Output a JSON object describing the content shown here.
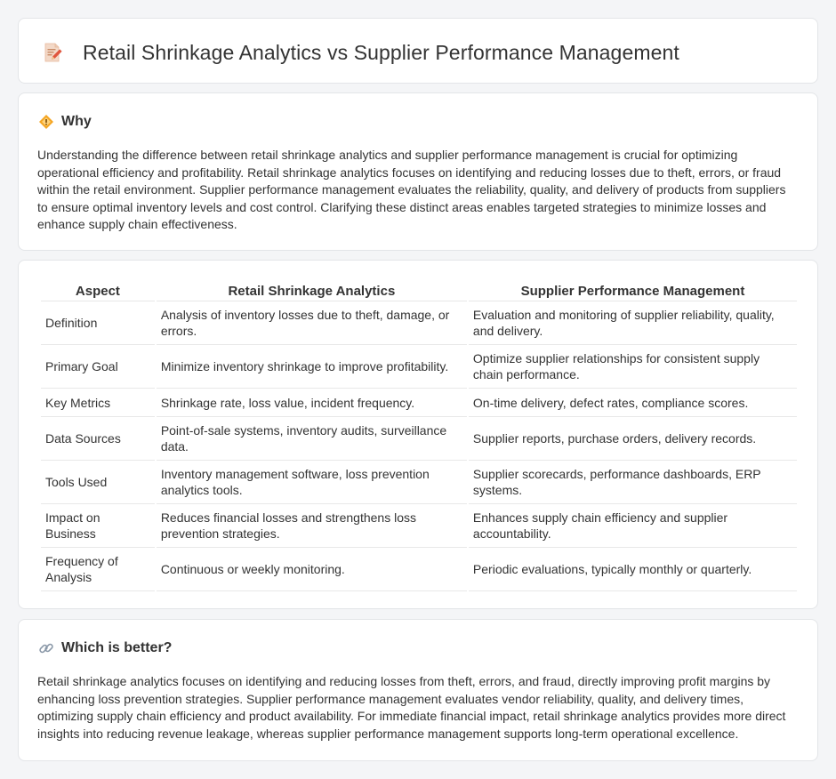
{
  "header": {
    "title": "Retail Shrinkage Analytics vs Supplier Performance Management",
    "icon": "document-pencil-icon"
  },
  "why": {
    "title": "Why",
    "icon": "diamond-warning-icon",
    "text": "Understanding the difference between retail shrinkage analytics and supplier performance management is crucial for optimizing operational efficiency and profitability. Retail shrinkage analytics focuses on identifying and reducing losses due to theft, errors, or fraud within the retail environment. Supplier performance management evaluates the reliability, quality, and delivery of products from suppliers to ensure optimal inventory levels and cost control. Clarifying these distinct areas enables targeted strategies to minimize losses and enhance supply chain effectiveness."
  },
  "table": {
    "headers": [
      "Aspect",
      "Retail Shrinkage Analytics",
      "Supplier Performance Management"
    ],
    "rows": [
      [
        "Definition",
        "Analysis of inventory losses due to theft, damage, or errors.",
        "Evaluation and monitoring of supplier reliability, quality, and delivery."
      ],
      [
        "Primary Goal",
        "Minimize inventory shrinkage to improve profitability.",
        "Optimize supplier relationships for consistent supply chain performance."
      ],
      [
        "Key Metrics",
        "Shrinkage rate, loss value, incident frequency.",
        "On-time delivery, defect rates, compliance scores."
      ],
      [
        "Data Sources",
        "Point-of-sale systems, inventory audits, surveillance data.",
        "Supplier reports, purchase orders, delivery records."
      ],
      [
        "Tools Used",
        "Inventory management software, loss prevention analytics tools.",
        "Supplier scorecards, performance dashboards, ERP systems."
      ],
      [
        "Impact on Business",
        "Reduces financial losses and strengthens loss prevention strategies.",
        "Enhances supply chain efficiency and supplier accountability."
      ],
      [
        "Frequency of Analysis",
        "Continuous or weekly monitoring.",
        "Periodic evaluations, typically monthly or quarterly."
      ]
    ]
  },
  "better": {
    "title": "Which is better?",
    "icon": "link-icon",
    "text": "Retail shrinkage analytics focuses on identifying and reducing losses from theft, errors, and fraud, directly improving profit margins by enhancing loss prevention strategies. Supplier performance management evaluates vendor reliability, quality, and delivery times, optimizing supply chain efficiency and product availability. For immediate financial impact, retail shrinkage analytics provides more direct insights into reducing revenue leakage, whereas supplier performance management supports long-term operational excellence."
  }
}
